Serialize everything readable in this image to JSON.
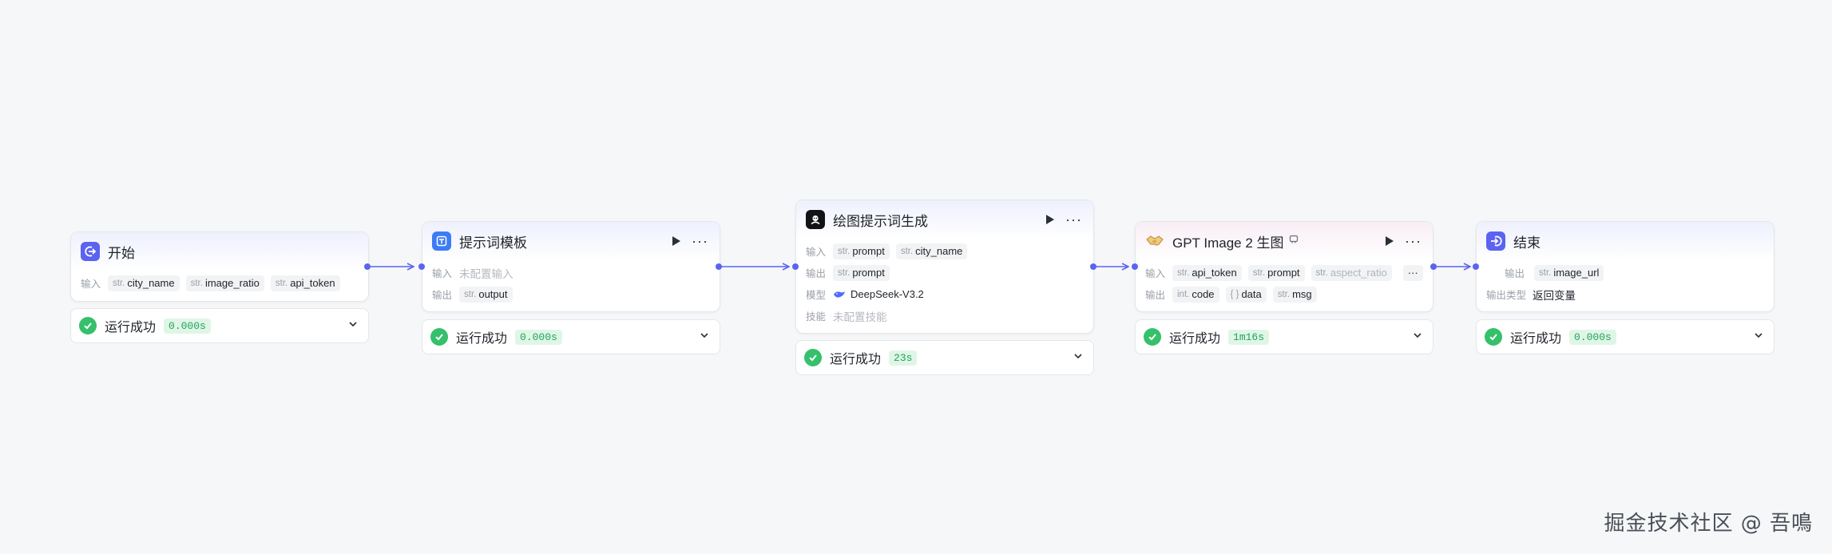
{
  "colors": {
    "accent": "#5b63f0",
    "success": "#35c06b",
    "success_bg": "#dff6e7"
  },
  "nodes": {
    "start": {
      "title": "开始",
      "input_label": "输入",
      "inputs": [
        {
          "type": "str.",
          "name": "city_name"
        },
        {
          "type": "str.",
          "name": "image_ratio"
        },
        {
          "type": "str.",
          "name": "api_token"
        }
      ],
      "status": "运行成功",
      "time": "0.000s"
    },
    "template": {
      "title": "提示词模板",
      "input_label": "输入",
      "input_value": "未配置输入",
      "output_label": "输出",
      "outputs": [
        {
          "type": "str.",
          "name": "output"
        }
      ],
      "status": "运行成功",
      "time": "0.000s"
    },
    "llm": {
      "title": "绘图提示词生成",
      "input_label": "输入",
      "inputs": [
        {
          "type": "str.",
          "name": "prompt"
        },
        {
          "type": "str.",
          "name": "city_name"
        }
      ],
      "output_label": "输出",
      "outputs": [
        {
          "type": "str.",
          "name": "prompt"
        }
      ],
      "model_label": "模型",
      "model": "DeepSeek-V3.2",
      "skill_label": "技能",
      "skill_value": "未配置技能",
      "status": "运行成功",
      "time": "23s"
    },
    "gpt": {
      "title": "GPT Image 2 生图",
      "input_label": "输入",
      "inputs": [
        {
          "type": "str.",
          "name": "api_token"
        },
        {
          "type": "str.",
          "name": "prompt"
        },
        {
          "type": "str.",
          "name": "aspect_ratio"
        }
      ],
      "input_more": "···",
      "output_label": "输出",
      "outputs": [
        {
          "type": "int.",
          "name": "code"
        },
        {
          "type": "{ }",
          "name": "data"
        },
        {
          "type": "str.",
          "name": "msg"
        }
      ],
      "status": "运行成功",
      "time": "1m16s"
    },
    "end": {
      "title": "结束",
      "output_label": "输出",
      "outputs": [
        {
          "type": "str.",
          "name": "image_url"
        }
      ],
      "output_type_label": "输出类型",
      "output_type": "返回变量",
      "status": "运行成功",
      "time": "0.000s"
    }
  },
  "watermark": "掘金技术社区 @ 吾鳴"
}
